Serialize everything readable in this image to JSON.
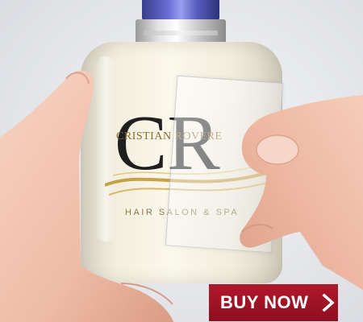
{
  "product": {
    "monogram": "CR",
    "brand_name": "CRISTIAN ROVERE",
    "tagline": "HAIR SALON & SPA"
  },
  "cta": {
    "label": "BUY NOW",
    "icon": "chevron-right-icon",
    "color": "#9e1326"
  },
  "colors": {
    "cap": "#5a5fc0",
    "bottle": "#f6f2e4",
    "logo_gold": "#b08a3a",
    "skin": "#f2c3b0"
  }
}
